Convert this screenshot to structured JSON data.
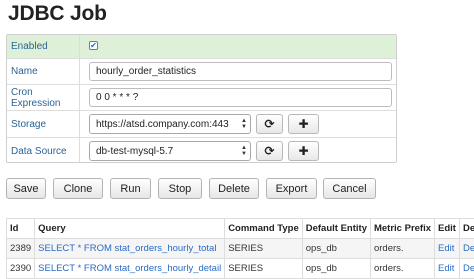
{
  "page": {
    "title": "JDBC Job"
  },
  "form": {
    "enabled": {
      "label": "Enabled",
      "checked": true
    },
    "name": {
      "label": "Name",
      "value": "hourly_order_statistics"
    },
    "cron": {
      "label": "Cron Expression",
      "value": "0 0 * * * ?"
    },
    "storage": {
      "label": "Storage",
      "value": "https://atsd.company.com:443"
    },
    "data_source": {
      "label": "Data Source",
      "value": "db-test-mysql-5.7"
    }
  },
  "icons": {
    "refresh": "refresh-icon",
    "add": "plus-icon",
    "check": "checkmark-icon"
  },
  "actions": [
    "Save",
    "Clone",
    "Run",
    "Stop",
    "Delete",
    "Export",
    "Cancel"
  ],
  "table": {
    "headers": [
      "Id",
      "Query",
      "Command Type",
      "Default Entity",
      "Metric Prefix",
      "Edit",
      "Delete"
    ],
    "rows": [
      {
        "id": "2389",
        "query": "SELECT * FROM stat_orders_hourly_total",
        "command_type": "SERIES",
        "default_entity": "ops_db",
        "metric_prefix": "orders.",
        "edit": "Edit",
        "delete": "Delete"
      },
      {
        "id": "2390",
        "query": "SELECT * FROM stat_orders_hourly_detail",
        "command_type": "SERIES",
        "default_entity": "ops_db",
        "metric_prefix": "orders.",
        "edit": "Edit",
        "delete": "Delete"
      }
    ]
  },
  "colors": {
    "link": "#2a6bc4",
    "enabled_row": "#dff0d8",
    "label": "#2a6496"
  }
}
